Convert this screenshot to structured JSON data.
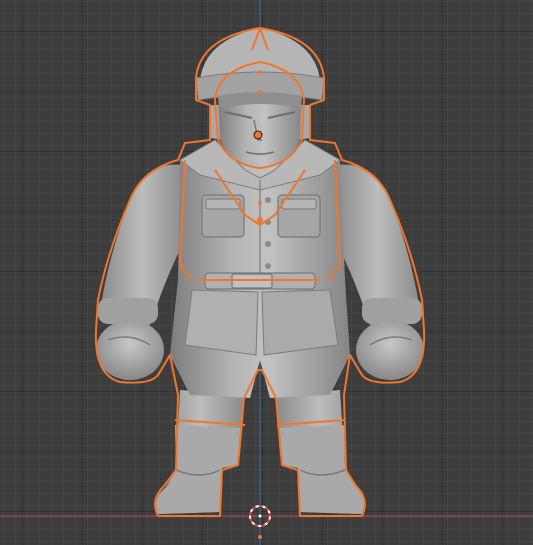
{
  "viewport": {
    "view": "front-orthographic",
    "object": "soldier-figure-mesh",
    "state": "selected"
  },
  "colors": {
    "background": "#3d3d3d",
    "grid_line": "#474747",
    "x_axis": "#b44a4f",
    "z_axis": "#3a6ea8",
    "selection_outline": "#f0762a",
    "origin_dot": "#f0762a",
    "mesh_base": "#9c9c9c",
    "mesh_highlight": "#c4c4c4",
    "mesh_shadow": "#6a6a6a",
    "cursor_red": "#e04040",
    "cursor_white": "#ffffff"
  },
  "icons": {
    "cursor": "3d-cursor-icon",
    "origin": "object-origin-icon"
  }
}
